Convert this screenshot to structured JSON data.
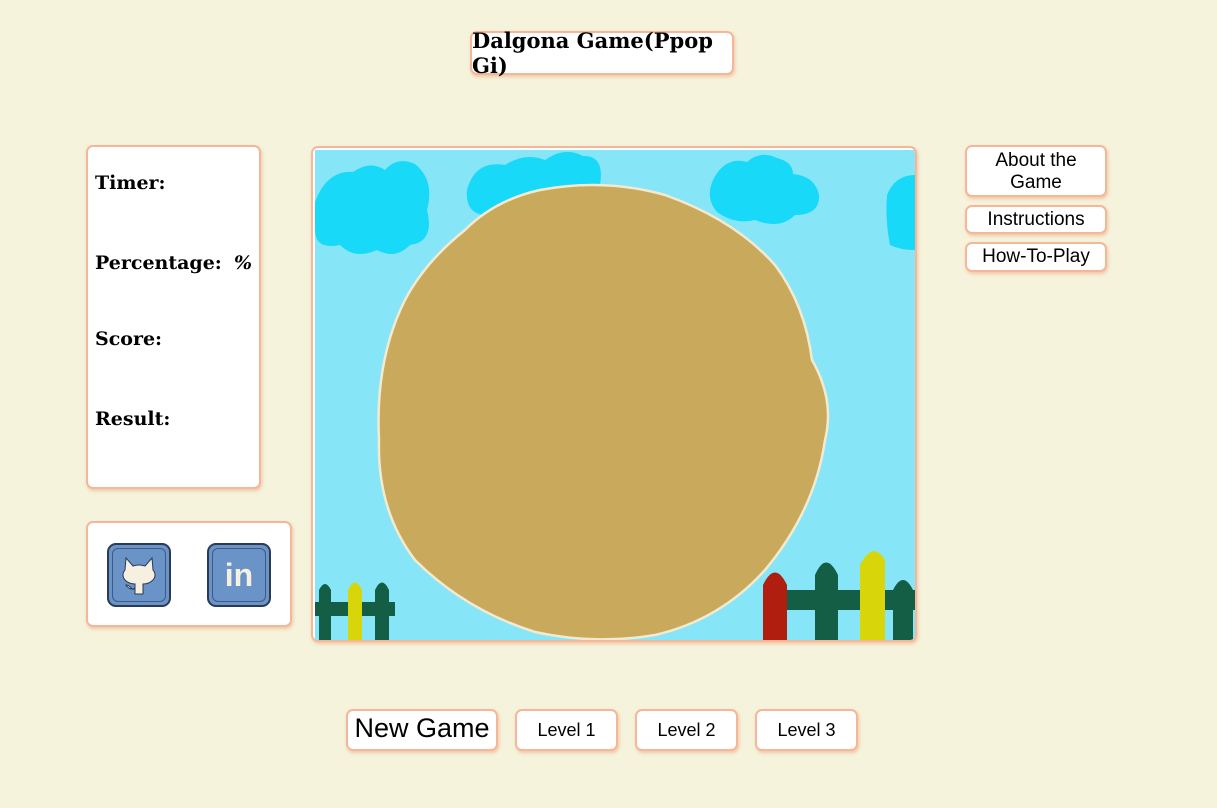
{
  "header": {
    "title": "Dalgona Game(Ppop Gi)"
  },
  "stats": {
    "timer_label": "Timer:",
    "percentage_label": "Percentage:",
    "percentage_unit": "%",
    "score_label": "Score:",
    "result_label": "Result:"
  },
  "social": {
    "github_icon": "github-octocat-icon",
    "linkedin_icon": "linkedin-icon",
    "linkedin_text": "in"
  },
  "side_menu": {
    "about": "About the Game",
    "instructions": "Instructions",
    "how_to_play": "How-To-Play"
  },
  "controls": {
    "new_game": "New Game",
    "level1": "Level 1",
    "level2": "Level 2",
    "level3": "Level 3"
  },
  "colors": {
    "background": "#f5f3dc",
    "border_accent": "#f4b79a",
    "sky": "#86e6f7",
    "cloud": "#19d9f9",
    "dalgona": "#c9a95c",
    "fence_green": "#135e45",
    "fence_yellow": "#d8d60a",
    "fence_red": "#b01e10",
    "social_blue": "#6a93c8"
  }
}
